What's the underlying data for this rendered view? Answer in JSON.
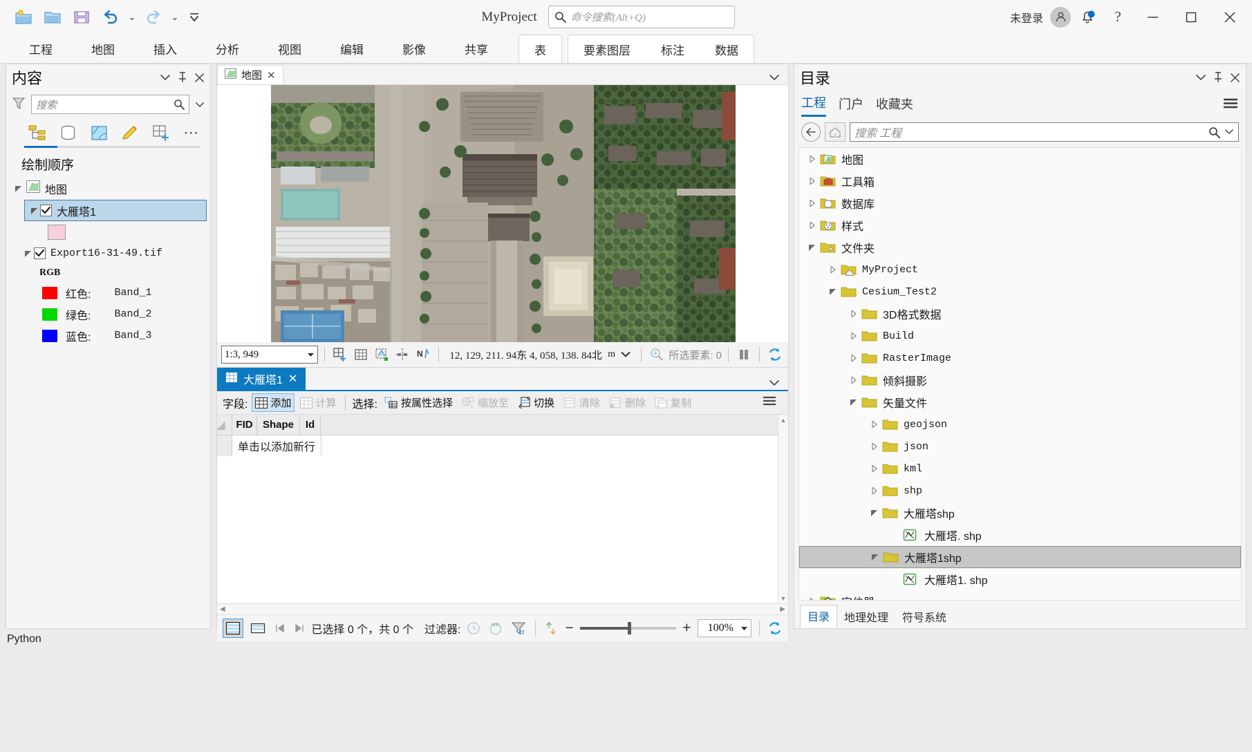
{
  "titlebar": {
    "quick_access": [
      {
        "name": "new-project-icon",
        "label": "新建工程"
      },
      {
        "name": "open-project-icon",
        "label": "打开工程"
      },
      {
        "name": "save-project-icon",
        "label": "保存工程"
      },
      {
        "name": "undo-icon",
        "label": "撤销"
      },
      {
        "name": "redo-icon",
        "label": "重做"
      },
      {
        "name": "customize-qat-icon",
        "label": "自定义快速访问工具栏"
      }
    ],
    "project_title": "MyProject",
    "command_search_placeholder": "命令搜索(Alt+Q)",
    "signin_label": "未登录",
    "help_label": "?",
    "window_controls": [
      "最小化",
      "最大化",
      "关闭"
    ]
  },
  "ribbon": {
    "tabs": [
      "工程",
      "地图",
      "插入",
      "分析",
      "视图",
      "编辑",
      "影像",
      "共享"
    ],
    "contextual_single": [
      "表"
    ],
    "contextual_group": [
      "要素图层",
      "标注",
      "数据"
    ]
  },
  "contents": {
    "title": "内容",
    "search_placeholder": "搜索",
    "tab_icons": [
      "list-by-drawing-order-icon",
      "list-by-data-source-icon",
      "list-by-selection-icon",
      "list-by-editing-icon",
      "list-by-snapping-icon",
      "more-icon"
    ],
    "draw_order_label": "绘制顺序",
    "tree": {
      "map_label": "地图",
      "layers": [
        {
          "label": "大雁塔1",
          "checked": true,
          "selected": true,
          "swatch": "#f7cfdd"
        },
        {
          "label": "Export16-31-49.tif",
          "checked": true,
          "selected": false
        }
      ],
      "raster_group": "RGB",
      "bands": [
        {
          "color": "#ff0000",
          "label": "红色:",
          "band": "Band_1"
        },
        {
          "color": "#00d800",
          "label": "绿色:",
          "band": "Band_2"
        },
        {
          "color": "#0000ff",
          "label": "蓝色:",
          "band": "Band_3"
        }
      ]
    }
  },
  "mapview": {
    "tab_label": "地图",
    "status": {
      "scale": "1:3, 949",
      "tools": [
        "add-selection-icon",
        "grid-icon",
        "select-by-rectangle-icon",
        "snapping-icon",
        "north-arrow-icon"
      ],
      "coordinates": "12, 129, 211. 94东  4, 058, 138. 84北",
      "unit": "m",
      "selected_features_label": "所选要素:",
      "selected_features_count": "0",
      "pause_label": "暂停绘制",
      "refresh_label": "刷新"
    }
  },
  "table": {
    "tab_label": "大雁塔1",
    "toolbar": {
      "fields_label": "字段:",
      "add_label": "添加",
      "calculate_label": "计算",
      "selection_label": "选择:",
      "select_by_attributes_label": "按属性选择",
      "zoom_to_label": "缩放至",
      "switch_label": "切换",
      "clear_label": "清除",
      "delete_label": "删除",
      "copy_label": "复制"
    },
    "columns": [
      "FID",
      "Shape",
      "Id"
    ],
    "new_row_text": "单击以添加新行",
    "status": {
      "view_table_label": "表视图",
      "view_split_label": "拆分视图",
      "records_text": "已选择 0 个，共 0 个",
      "filter_label": "过滤器:",
      "filter_icons": [
        "time-filter-icon",
        "range-filter-icon",
        "selection-filter-icon",
        "updown-arrow-icon"
      ],
      "zoom_value": "100%",
      "refresh_label": "刷新"
    }
  },
  "catalog": {
    "title": "目录",
    "tabs": [
      {
        "label": "工程",
        "active": true
      },
      {
        "label": "门户",
        "active": false
      },
      {
        "label": "收藏夹",
        "active": false
      }
    ],
    "search_placeholder": "搜索 工程",
    "tree": [
      {
        "label": "地图",
        "depth": 0,
        "expander": "collapsed",
        "icon": "map-folder-icon",
        "selected": false
      },
      {
        "label": "工具箱",
        "depth": 0,
        "expander": "collapsed",
        "icon": "toolbox-folder-icon",
        "selected": false
      },
      {
        "label": "数据库",
        "depth": 0,
        "expander": "collapsed",
        "icon": "database-folder-icon",
        "selected": false
      },
      {
        "label": "样式",
        "depth": 0,
        "expander": "collapsed",
        "icon": "style-folder-icon",
        "selected": false
      },
      {
        "label": "文件夹",
        "depth": 0,
        "expander": "expanded",
        "icon": "folders-icon",
        "selected": false
      },
      {
        "label": "MyProject",
        "depth": 1,
        "expander": "collapsed",
        "icon": "home-folder-icon",
        "selected": false
      },
      {
        "label": "Cesium_Test2",
        "depth": 1,
        "expander": "expanded",
        "icon": "folder-icon",
        "selected": false
      },
      {
        "label": "3D格式数据",
        "depth": 2,
        "expander": "collapsed",
        "icon": "folder-icon",
        "selected": false
      },
      {
        "label": "Build",
        "depth": 2,
        "expander": "collapsed",
        "icon": "folder-icon",
        "selected": false
      },
      {
        "label": "RasterImage",
        "depth": 2,
        "expander": "collapsed",
        "icon": "folder-icon",
        "selected": false
      },
      {
        "label": "倾斜摄影",
        "depth": 2,
        "expander": "collapsed",
        "icon": "folder-icon",
        "selected": false
      },
      {
        "label": "矢量文件",
        "depth": 2,
        "expander": "expanded",
        "icon": "folder-icon",
        "selected": false
      },
      {
        "label": "geojson",
        "depth": 3,
        "expander": "collapsed",
        "icon": "folder-icon",
        "selected": false
      },
      {
        "label": "json",
        "depth": 3,
        "expander": "collapsed",
        "icon": "folder-icon",
        "selected": false
      },
      {
        "label": "kml",
        "depth": 3,
        "expander": "collapsed",
        "icon": "folder-icon",
        "selected": false
      },
      {
        "label": "shp",
        "depth": 3,
        "expander": "collapsed",
        "icon": "folder-icon",
        "selected": false
      },
      {
        "label": "大雁塔shp",
        "depth": 3,
        "expander": "expanded",
        "icon": "folder-icon",
        "selected": false
      },
      {
        "label": "大雁塔. shp",
        "depth": 4,
        "expander": "none",
        "icon": "shapefile-icon",
        "selected": false
      },
      {
        "label": "大雁塔1shp",
        "depth": 3,
        "expander": "expanded",
        "icon": "folder-icon",
        "selected": true
      },
      {
        "label": "大雁塔1. shp",
        "depth": 4,
        "expander": "none",
        "icon": "shapefile-icon",
        "selected": false
      },
      {
        "label": "定位器",
        "depth": 0,
        "expander": "collapsed",
        "icon": "locator-folder-icon",
        "selected": false
      }
    ],
    "bottom_tabs": [
      {
        "label": "目录",
        "active": true
      },
      {
        "label": "地理处理",
        "active": false
      },
      {
        "label": "符号系统",
        "active": false
      }
    ]
  },
  "statusbar": {
    "python_label": "Python"
  },
  "colors": {
    "accent_blue": "#0c7ac0",
    "tab_underline": "#1475bd",
    "selection_blue": "#bcd6ea",
    "folder_yellow": "#d9c533",
    "layer_swatch_pink": "#f7cfdd"
  }
}
